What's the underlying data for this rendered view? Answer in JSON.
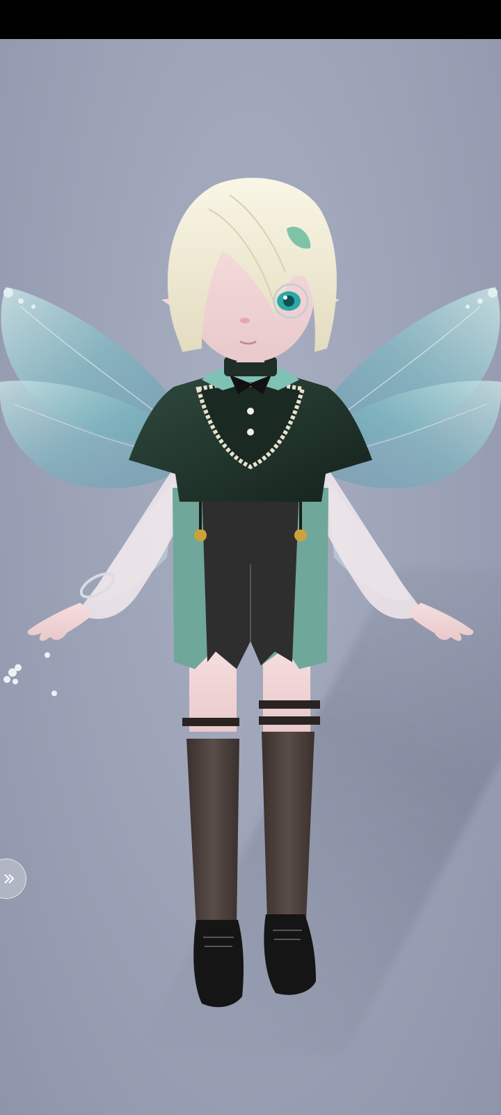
{
  "scene": {
    "background_color": "#9fa4b6",
    "top_bar_color": "#000000"
  },
  "avatar": {
    "hair_color": "#f1ecd6",
    "top_color": "#1e2e26",
    "collar_color": "#7fc1b4",
    "shorts_color": "#6fa79b",
    "stockings_color": "#4a3f3b",
    "wing_color": "#7fb9c2"
  },
  "controls": {
    "side_button_icon": "double-chevron-right-icon"
  }
}
